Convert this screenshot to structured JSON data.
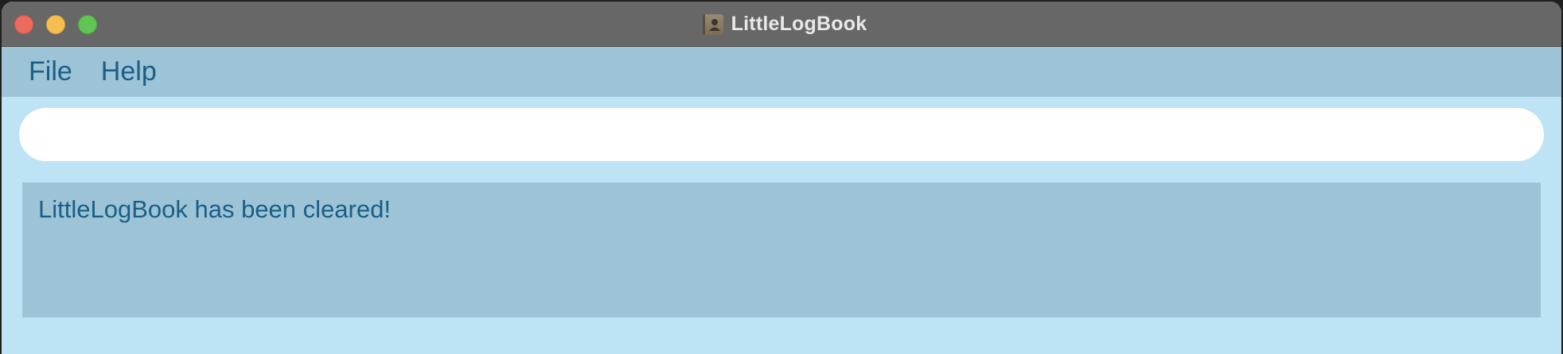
{
  "window": {
    "title": "LittleLogBook",
    "app_icon": "address-book-icon"
  },
  "menubar": {
    "items": [
      {
        "label": "File"
      },
      {
        "label": "Help"
      }
    ]
  },
  "command_box": {
    "value": "",
    "placeholder": ""
  },
  "result_display": {
    "message": "LittleLogBook has been cleared!"
  },
  "colors": {
    "titlebar": "#676767",
    "menubar": "#9dc3d6",
    "background": "#bde3f4",
    "text": "#195f86"
  }
}
